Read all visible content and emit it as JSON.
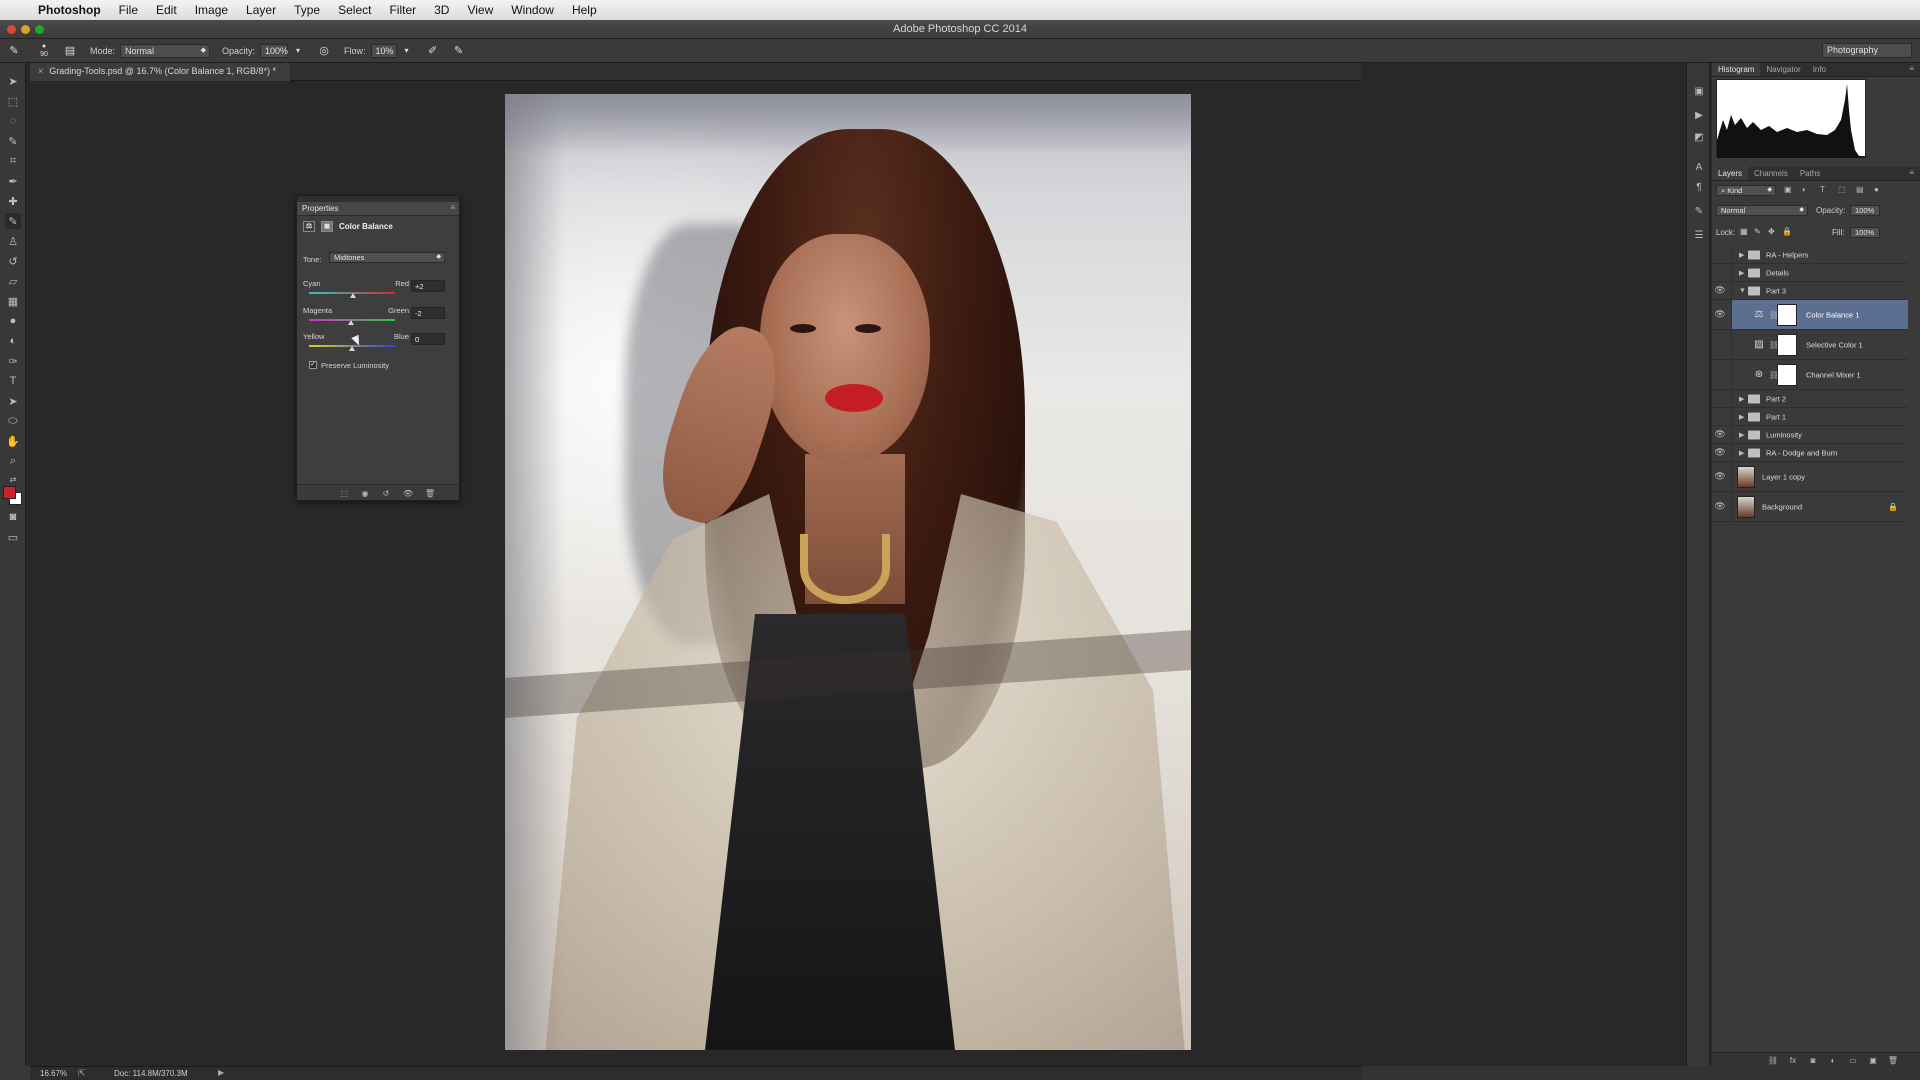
{
  "menubar": {
    "app_name": "Photoshop",
    "items": [
      "File",
      "Edit",
      "Image",
      "Layer",
      "Type",
      "Select",
      "Filter",
      "3D",
      "View",
      "Window",
      "Help"
    ]
  },
  "window": {
    "title": "Adobe Photoshop CC 2014"
  },
  "options": {
    "brush_size": "90",
    "mode_label": "Mode:",
    "mode_value": "Normal",
    "opacity_label": "Opacity:",
    "opacity_value": "100%",
    "flow_label": "Flow:",
    "flow_value": "10%",
    "workspace": "Photography"
  },
  "document": {
    "tab_title": "Grading-Tools.psd @ 16.7% (Color Balance 1, RGB/8*) *"
  },
  "properties": {
    "header": "Properties",
    "title": "Color Balance",
    "tone_label": "Tone:",
    "tone_value": "Midtones",
    "sliders": [
      {
        "left": "Cyan",
        "right": "Red",
        "value": "+2",
        "position": 0.51
      },
      {
        "left": "Magenta",
        "right": "Green",
        "value": "-2",
        "position": 0.49
      },
      {
        "left": "Yellow",
        "right": "Blue",
        "value": "0",
        "position": 0.5
      }
    ],
    "preserve_luminosity": "Preserve Luminosity",
    "preserve_checked": true
  },
  "histogram_panel": {
    "tabs": [
      "Histogram",
      "Navigator",
      "Info"
    ]
  },
  "layers_panel": {
    "tabs": [
      "Layers",
      "Channels",
      "Paths"
    ],
    "filter_kind": "Kind",
    "blend_mode": "Normal",
    "opacity_label": "Opacity:",
    "opacity_value": "100%",
    "lock_label": "Lock:",
    "fill_label": "Fill:",
    "fill_value": "100%",
    "layers": [
      {
        "name": "RA - Helpers",
        "type": "group",
        "visible": false,
        "expanded": false
      },
      {
        "name": "Details",
        "type": "group",
        "visible": false,
        "expanded": false
      },
      {
        "name": "Part 3",
        "type": "group",
        "visible": true,
        "expanded": true
      },
      {
        "name": "Color Balance 1",
        "type": "adjustment",
        "visible": true,
        "selected": true,
        "icon": "balance-icon"
      },
      {
        "name": "Selective Color 1",
        "type": "adjustment",
        "visible": false,
        "icon": "selective-color-icon"
      },
      {
        "name": "Channel Mixer 1",
        "type": "adjustment",
        "visible": false,
        "icon": "channel-mixer-icon"
      },
      {
        "name": "Part 2",
        "type": "group",
        "visible": false,
        "expanded": false
      },
      {
        "name": "Part 1",
        "type": "group",
        "visible": false,
        "expanded": false
      },
      {
        "name": "Luminosity",
        "type": "group",
        "visible": true,
        "expanded": false
      },
      {
        "name": "RA - Dodge and Burn",
        "type": "group",
        "visible": true,
        "expanded": false
      },
      {
        "name": "Layer 1 copy",
        "type": "image",
        "visible": true
      },
      {
        "name": "Background",
        "type": "image",
        "visible": true,
        "locked": true
      }
    ]
  },
  "status": {
    "zoom": "16.67%",
    "doc": "Doc: 114.8M/370.3M"
  },
  "colors": {
    "foreground": "#c8222a",
    "background": "#ffffff",
    "selection": "#5b7090"
  }
}
